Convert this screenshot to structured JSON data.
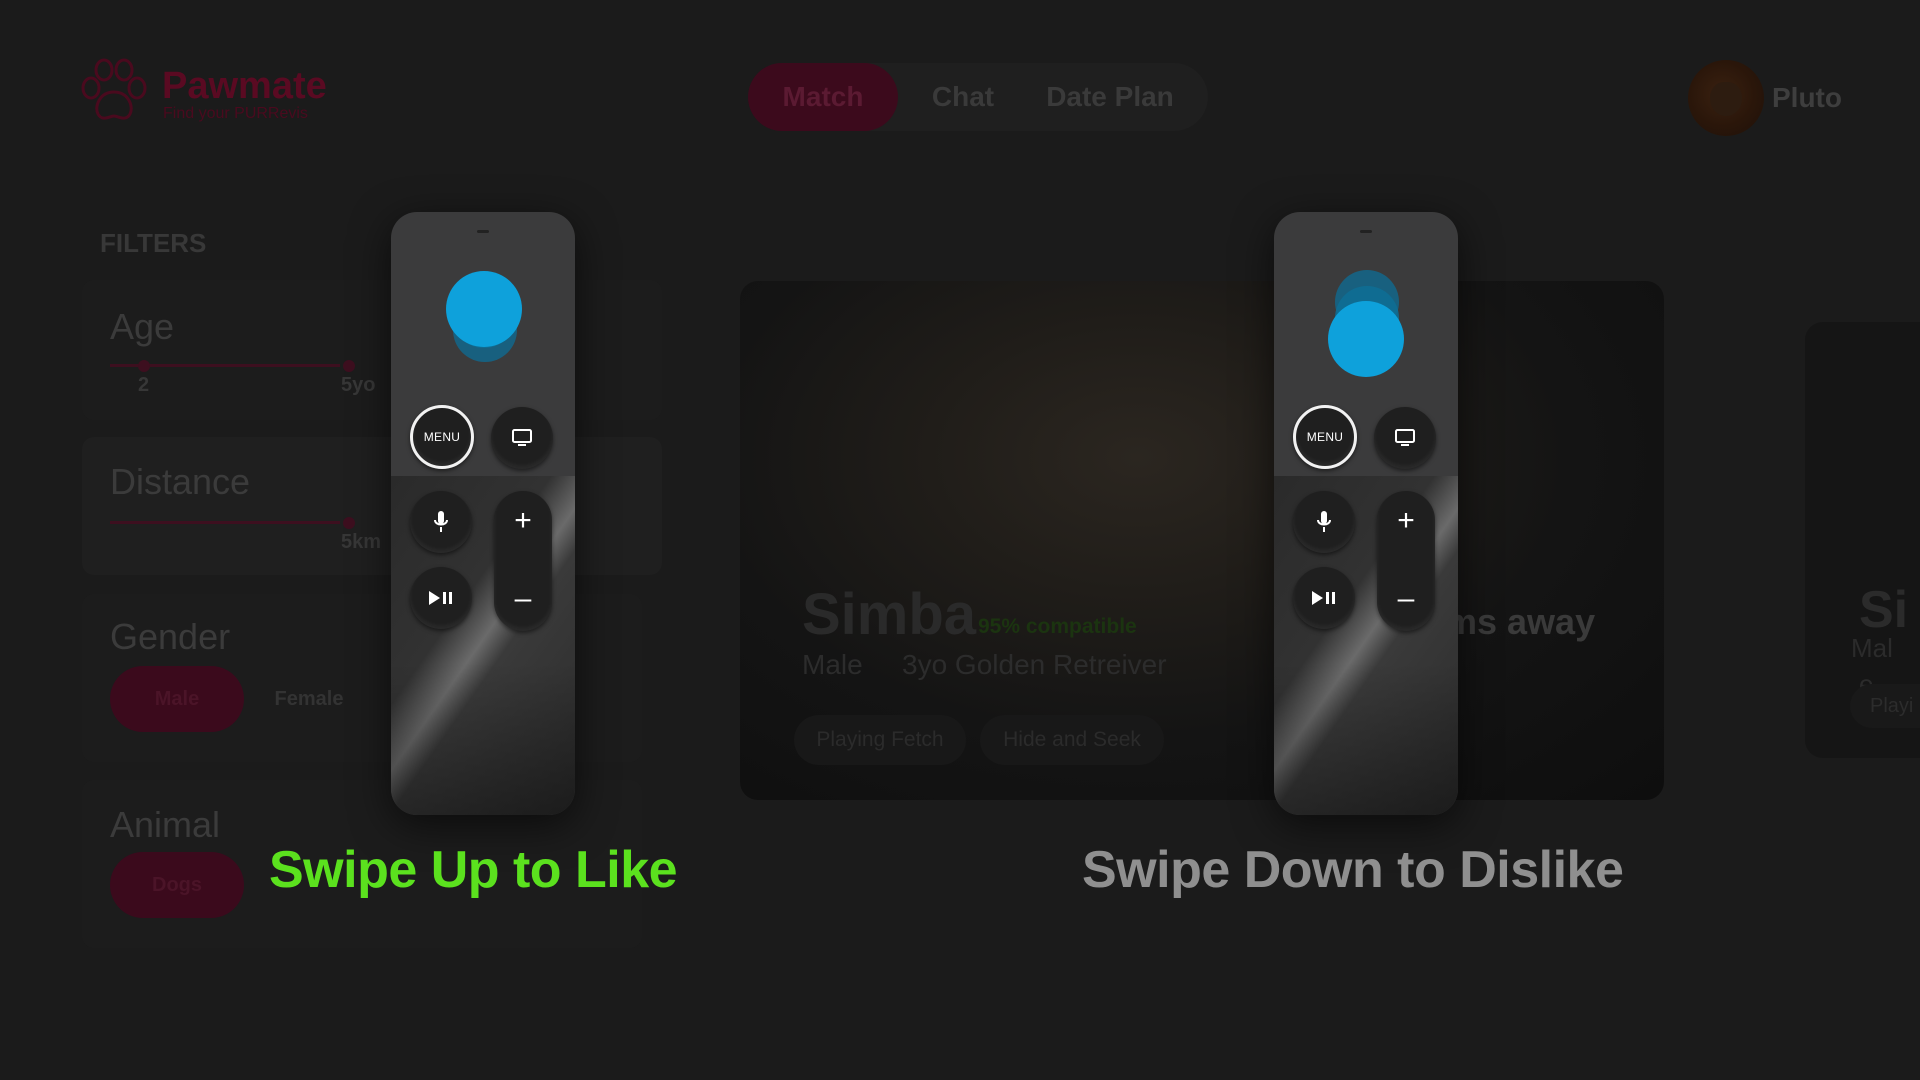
{
  "app": {
    "brand": "Pawmate",
    "tagline": "Find your PURRevis",
    "nav": {
      "tabs": [
        "Match",
        "Chat",
        "Date Plan"
      ],
      "active": "Match"
    },
    "user": {
      "name": "Pluto"
    }
  },
  "filters": {
    "title": "FILTERS",
    "age": {
      "label": "Age",
      "min": "2",
      "max": "5yo"
    },
    "distance": {
      "label": "Distance",
      "value": "5km"
    },
    "gender": {
      "label": "Gender",
      "options": [
        "Male",
        "Female"
      ],
      "selected": "Male"
    },
    "animal": {
      "label": "Animal",
      "options": [
        "Dogs"
      ],
      "selected": "Dogs"
    }
  },
  "card": {
    "name": "Simba",
    "compatibility": "95% compatible",
    "gender": "Male",
    "breed": "3yo Golden Retreiver",
    "distance_fragment": "ms away",
    "tags": [
      "Playing Fetch",
      "Hide and Seek"
    ]
  },
  "next_card": {
    "name": "Si",
    "sub_line1": "Mal",
    "sub_line2": "e",
    "tag": "Playi"
  },
  "remotes": [
    {
      "menu_label": "MENU",
      "gesture": "swipe up",
      "caption": "Swipe Up to Like"
    },
    {
      "menu_label": "MENU",
      "gesture": "swipe down",
      "caption": "Swipe Down to Dislike"
    }
  ],
  "colors": {
    "accent": "#5a0a22",
    "touch": "#0ea1db",
    "like": "#5be11e",
    "dislike": "#8f8f8f",
    "compatible": "#1b3410"
  },
  "icons": [
    "paw-logo-icon",
    "tv-icon",
    "microphone-icon",
    "play-pause-icon",
    "plus-icon",
    "minus-icon"
  ]
}
